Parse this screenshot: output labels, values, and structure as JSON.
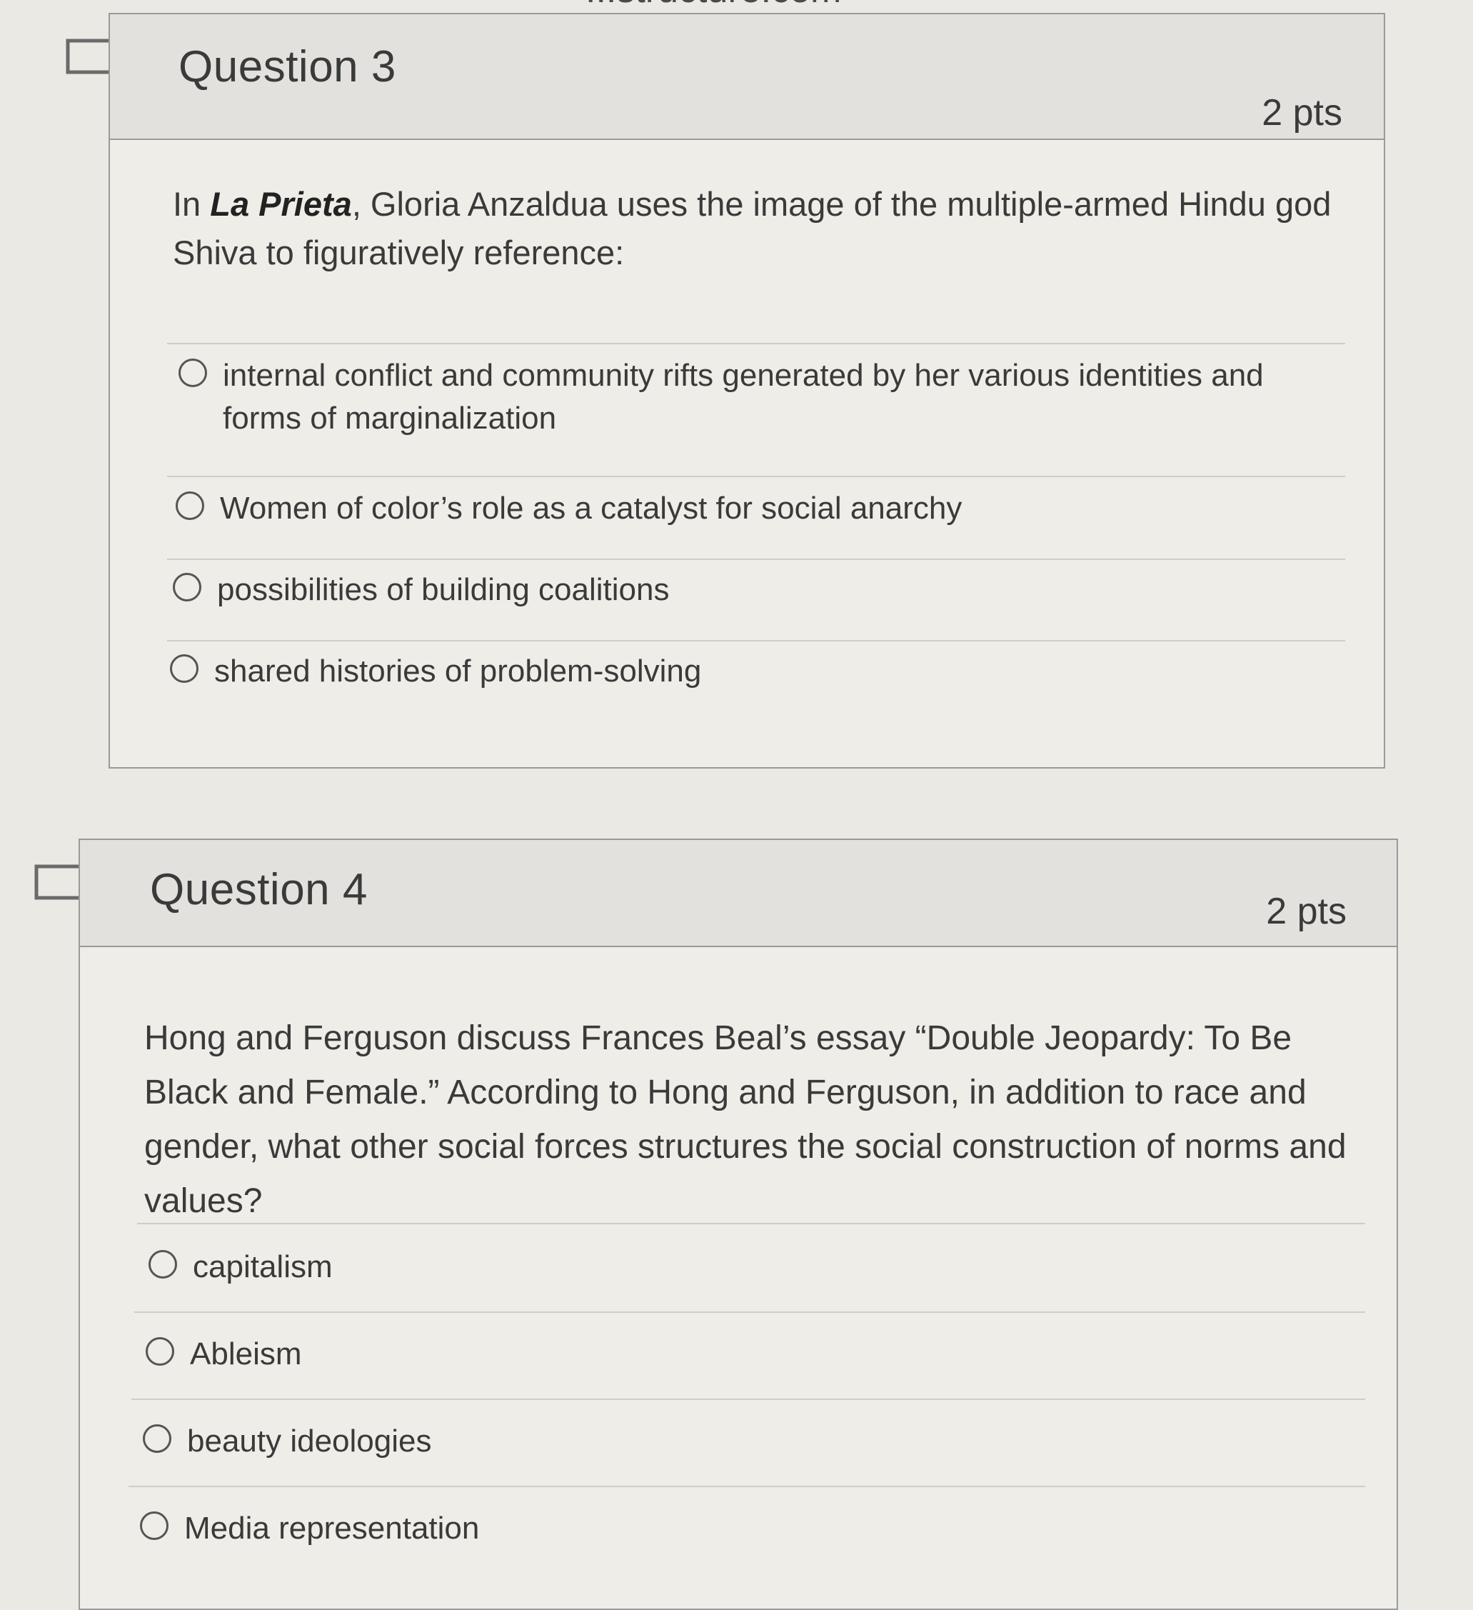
{
  "page": {
    "top_url_fragment": "...structure.com"
  },
  "questions": [
    {
      "title": "Question 3",
      "points": "2 pts",
      "prompt": {
        "intro": "In ",
        "work_title": "La Prieta",
        "rest": ", Gloria Anzaldua uses the image of the multiple-armed Hindu god Shiva to figuratively reference:"
      },
      "answers": [
        "internal conflict and community rifts generated by her various identities and forms of marginalization",
        "Women of color’s role as a catalyst for social anarchy",
        "possibilities of building coalitions",
        "shared histories of problem-solving"
      ]
    },
    {
      "title": "Question 4",
      "points": "2 pts",
      "prompt": {
        "text": "Hong and Ferguson discuss Frances Beal’s essay “Double Jeopardy: To Be Black and Female.” According to Hong and Ferguson, in addition to race and gender, what other social forces structures the social construction of norms and values?"
      },
      "answers": [
        "capitalism",
        "Ableism",
        "beauty ideologies",
        "Media representation"
      ]
    }
  ],
  "icons": {
    "flag": "flag-bookmark-icon",
    "radio": "radio-button-unselected"
  },
  "colors": {
    "page_background": "#ebe9e4",
    "card_background": "#efede8",
    "header_background": "#e2e1dd",
    "border": "#9a9a9a",
    "text": "#3a3a3a"
  }
}
